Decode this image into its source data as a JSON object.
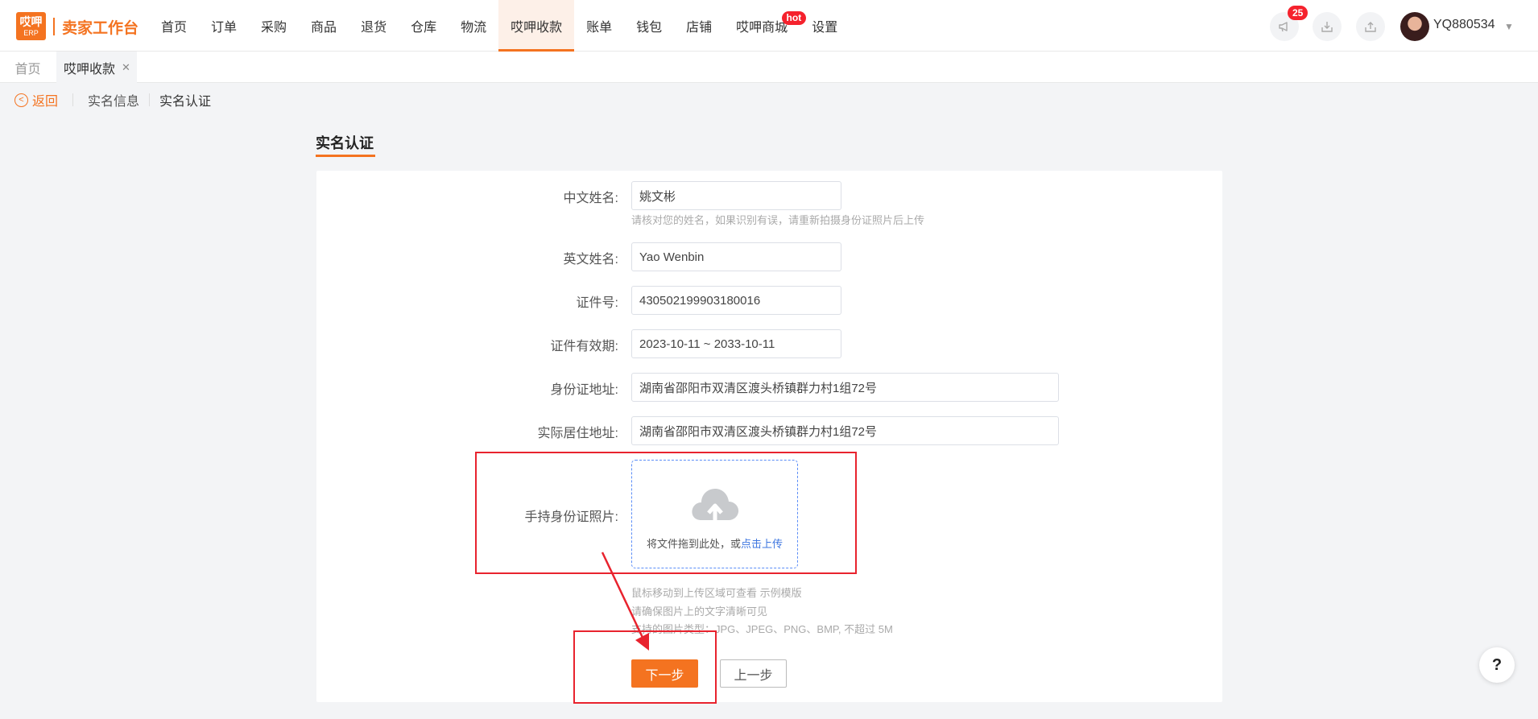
{
  "logo": {
    "mark_top": "哎呷",
    "mark_bottom": "ERP",
    "title": "卖家工作台"
  },
  "nav": {
    "items": [
      {
        "label": "首页"
      },
      {
        "label": "订单"
      },
      {
        "label": "采购"
      },
      {
        "label": "商品"
      },
      {
        "label": "退货"
      },
      {
        "label": "仓库"
      },
      {
        "label": "物流"
      },
      {
        "label": "哎呷收款",
        "active": true
      },
      {
        "label": "账单"
      },
      {
        "label": "钱包"
      },
      {
        "label": "店铺"
      },
      {
        "label": "哎呷商城",
        "badge": "hot"
      },
      {
        "label": "设置"
      }
    ]
  },
  "toolbar": {
    "notification_count": "25",
    "icons": [
      "megaphone-icon",
      "download-icon",
      "upload-icon"
    ],
    "username": "YQ880534"
  },
  "tabs": {
    "home": "首页",
    "active": "哎呷收款"
  },
  "breadcrumb": {
    "back": "返回",
    "step1": "实名信息",
    "step2": "实名认证"
  },
  "section": {
    "title": "实名认证"
  },
  "form": {
    "cn_name": {
      "label": "中文姓名:",
      "value": "姚文彬",
      "hint": "请核对您的姓名，如果识别有误，请重新拍摄身份证照片后上传"
    },
    "en_name": {
      "label": "英文姓名:",
      "value": "Yao Wenbin"
    },
    "id_number": {
      "label": "证件号:",
      "value": "430502199903180016"
    },
    "validity": {
      "label": "证件有效期:",
      "value": "2023-10-11 ~ 2033-10-11"
    },
    "id_address": {
      "label": "身份证地址:",
      "value": "湖南省邵阳市双清区渡头桥镇群力村1组72号"
    },
    "live_address": {
      "label": "实际居住地址:",
      "value": "湖南省邵阳市双清区渡头桥镇群力村1组72号"
    },
    "photo": {
      "label": "手持身份证照片:",
      "drop_text": "将文件拖到此处，或",
      "drop_link": "点击上传",
      "hint1": "鼠标移动到上传区域可查看 示例模版",
      "hint2": "请确保图片上的文字清晰可见",
      "hint3": "支持的图片类型：JPG、JPEG、PNG、BMP, 不超过 5M"
    },
    "next_label": "下一步",
    "prev_label": "上一步"
  },
  "help": {
    "label": "?"
  },
  "colors": {
    "accent": "#f47320",
    "annotation": "#e8232e",
    "link": "#3f77e0"
  }
}
